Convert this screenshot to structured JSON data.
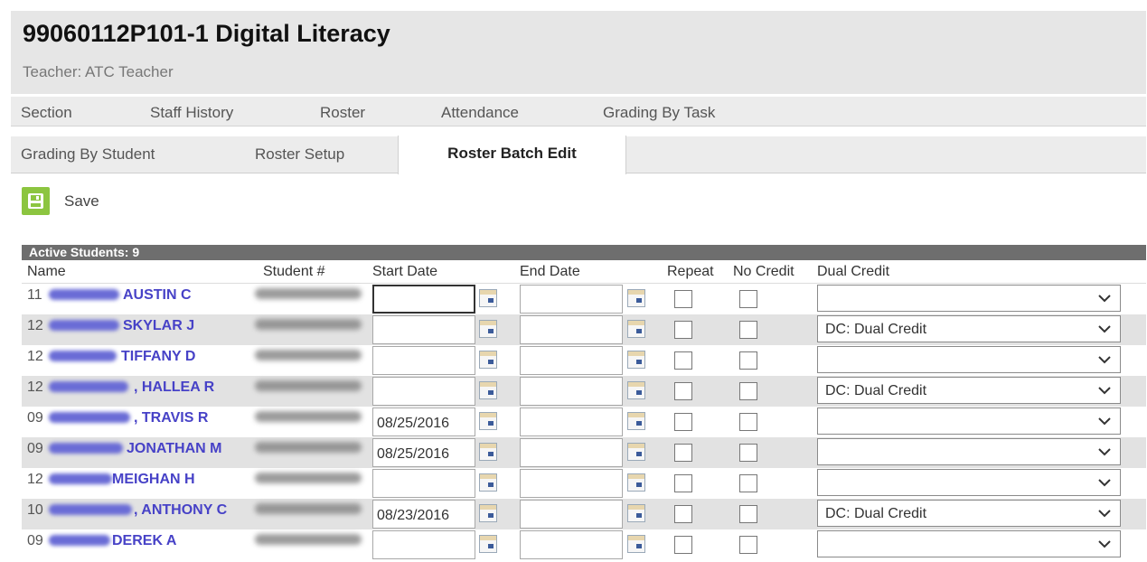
{
  "header": {
    "title": "99060112P101-1 Digital Literacy",
    "teacher": "Teacher: ATC Teacher"
  },
  "tabs_row1": [
    {
      "label": "Section"
    },
    {
      "label": "Staff History"
    },
    {
      "label": "Roster"
    },
    {
      "label": "Attendance"
    },
    {
      "label": "Grading By Task"
    }
  ],
  "tabs_row2": [
    {
      "label": "Grading By Student"
    },
    {
      "label": "Roster Setup"
    },
    {
      "label": "Roster Batch Edit",
      "active": true
    }
  ],
  "toolbar": {
    "save_label": "Save",
    "save_icon": "floppy-disk-icon",
    "save_color": "#8cc540"
  },
  "table": {
    "heading": "Active Students: 9",
    "columns": {
      "name": "Name",
      "student_num": "Student #",
      "start_date": "Start Date",
      "end_date": "End Date",
      "repeat": "Repeat",
      "no_credit": "No Credit",
      "dual_credit": "Dual Credit"
    },
    "rows": [
      {
        "grade": "11",
        "name": "AUSTIN C",
        "start_date": "",
        "end_date": "",
        "dual_credit": ""
      },
      {
        "grade": "12",
        "name": "SKYLAR J",
        "start_date": "",
        "end_date": "",
        "dual_credit": "DC: Dual Credit"
      },
      {
        "grade": "12",
        "name": "TIFFANY D",
        "start_date": "",
        "end_date": "",
        "dual_credit": ""
      },
      {
        "grade": "12",
        "name": ", HALLEA R",
        "start_date": "",
        "end_date": "",
        "dual_credit": "DC: Dual Credit"
      },
      {
        "grade": "09",
        "name": ", TRAVIS R",
        "start_date": "08/25/2016",
        "end_date": "",
        "dual_credit": ""
      },
      {
        "grade": "09",
        "name": "JONATHAN M",
        "start_date": "08/25/2016",
        "end_date": "",
        "dual_credit": ""
      },
      {
        "grade": "12",
        "name": "MEIGHAN H",
        "start_date": "",
        "end_date": "",
        "dual_credit": ""
      },
      {
        "grade": "10",
        "name": ", ANTHONY C",
        "start_date": "08/23/2016",
        "end_date": "",
        "dual_credit": "DC: Dual Credit"
      },
      {
        "grade": "09",
        "name": "DEREK A",
        "start_date": "",
        "end_date": "",
        "dual_credit": ""
      }
    ]
  }
}
